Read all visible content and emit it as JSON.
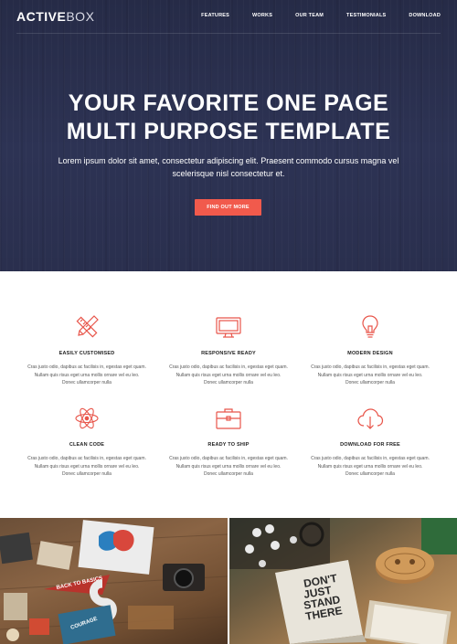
{
  "brand": {
    "bold": "ACTIVE",
    "light": "BOX"
  },
  "nav": [
    "FEATURES",
    "WORKS",
    "OUR TEAM",
    "TESTIMONIALS",
    "DOWNLOAD"
  ],
  "hero": {
    "title_line1": "YOUR FAVORITE ONE PAGE",
    "title_line2": "MULTI PURPOSE TEMPLATE",
    "subtitle": "Lorem ipsum dolor sit amet, consectetur adipiscing elit. Praesent commodo cursus magna vel scelerisque nisl consectetur et.",
    "cta_label": "FIND OUT MORE"
  },
  "features": [
    {
      "title": "EASILY CUSTOMISED",
      "icon": "pencil-ruler-icon",
      "desc": "Cras justo odio, dapibus ac facilisis in, egestas eget quam. Nullam quis risus eget urna mollis ornare vel eu leo. Donec ullamcorper nulla"
    },
    {
      "title": "RESPONSIVE READY",
      "icon": "monitor-icon",
      "desc": "Cras justo odio, dapibus ac facilisis in, egestas eget quam. Nullam quis risus eget urna mollis ornare vel eu leo. Donec ullamcorper nulla"
    },
    {
      "title": "MODERN DESIGN",
      "icon": "lightbulb-icon",
      "desc": "Cras justo odio, dapibus ac facilisis in, egestas eget quam. Nullam quis risus eget urna mollis ornare vel eu leo. Donec ullamcorper nulla"
    },
    {
      "title": "CLEAN CODE",
      "icon": "atom-icon",
      "desc": "Cras justo odio, dapibus ac facilisis in, egestas eget quam. Nullam quis risus eget urna mollis ornare vel eu leo. Donec ullamcorper nulla"
    },
    {
      "title": "READY TO SHIP",
      "icon": "briefcase-icon",
      "desc": "Cras justo odio, dapibus ac facilisis in, egestas eget quam. Nullam quis risus eget urna mollis ornare vel eu leo. Donec ullamcorper nulla"
    },
    {
      "title": "DOWNLOAD FOR FREE",
      "icon": "cloud-download-icon",
      "desc": "Cras justo odio, dapibus ac facilisis in, egestas eget quam. Nullam quis risus eget urna mollis ornare vel eu leo. Donec ullamcorper nulla"
    }
  ],
  "photos": {
    "left_pennant": "BACK TO BASICS",
    "left_badge": "COURAGE",
    "right_book": [
      "DON'T",
      "JUST",
      "STAND",
      "THERE"
    ]
  },
  "colors": {
    "accent": "#f15a4c",
    "hero_bg": "#2a2f4f",
    "icon_stroke": "#e8554a"
  }
}
